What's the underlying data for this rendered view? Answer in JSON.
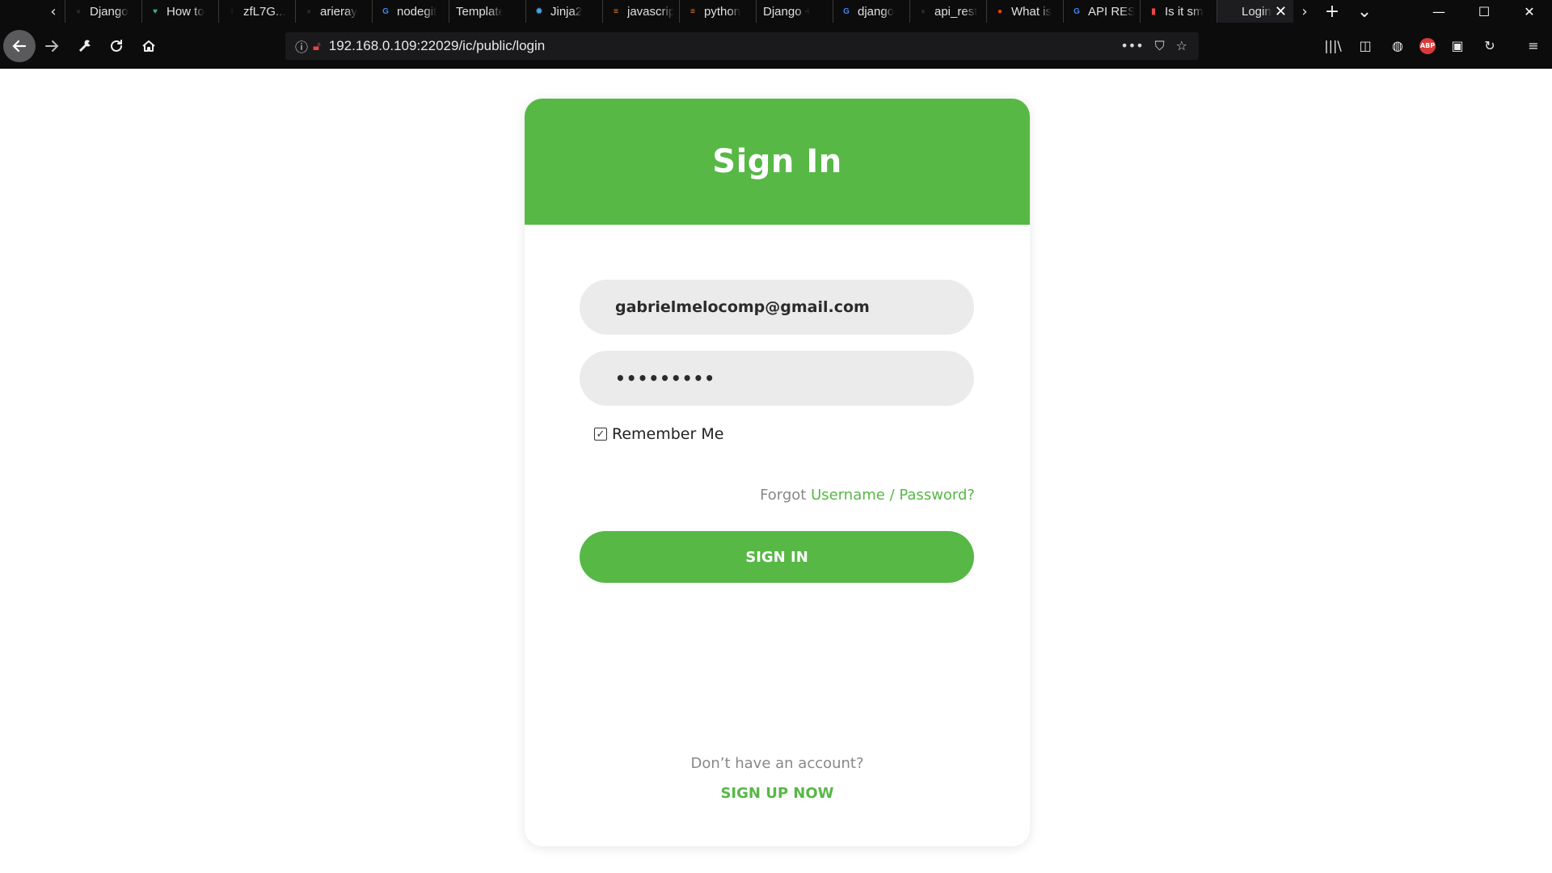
{
  "browser": {
    "tabs": [
      {
        "title": "Django",
        "icon": "github-icon",
        "color": "#24292e"
      },
      {
        "title": "How to",
        "icon": "vue-icon",
        "color": "#3fb27f"
      },
      {
        "title": "zfL7G...",
        "icon": "info-icon",
        "color": "#222222"
      },
      {
        "title": "arieray",
        "icon": "github-icon",
        "color": "#24292e"
      },
      {
        "title": "nodegit",
        "icon": "google-icon",
        "color": "#ffffff"
      },
      {
        "title": "Template",
        "icon": "",
        "color": ""
      },
      {
        "title": "Jinja2",
        "icon": "jinja-icon",
        "color": "#4aa3df"
      },
      {
        "title": "javascript",
        "icon": "stackoverflow-icon",
        "color": "#f48024"
      },
      {
        "title": "python",
        "icon": "stackoverflow-icon",
        "color": "#f48024"
      },
      {
        "title": "Django + V",
        "icon": "",
        "color": ""
      },
      {
        "title": "django",
        "icon": "google-icon",
        "color": "#ffffff"
      },
      {
        "title": "api_rest",
        "icon": "github-icon",
        "color": "#24292e"
      },
      {
        "title": "What is",
        "icon": "reddit-icon",
        "color": "#ff4500"
      },
      {
        "title": "API REST",
        "icon": "google-icon",
        "color": "#ffffff"
      },
      {
        "title": "Is it sm",
        "icon": "bottle-icon",
        "color": "#e44"
      },
      {
        "title": "Login",
        "icon": "home-icon",
        "color": "#222"
      }
    ],
    "url": "192.168.0.109:22029/ic/public/login",
    "addon_abp": "ABP"
  },
  "login": {
    "title": "Sign In",
    "email_value": "gabrielmelocomp@gmail.com",
    "password_value": "•••••••••",
    "remember_label": "Remember Me",
    "remember_checked": true,
    "forgot_prefix": "Forgot ",
    "forgot_link": "Username / Password?",
    "signin_button": "SIGN IN",
    "no_account": "Don’t have an account?",
    "signup_link": "SIGN UP NOW"
  },
  "colors": {
    "accent": "#57b846",
    "chrome_dark": "#0c0c0d",
    "field_bg": "#ebebeb"
  }
}
